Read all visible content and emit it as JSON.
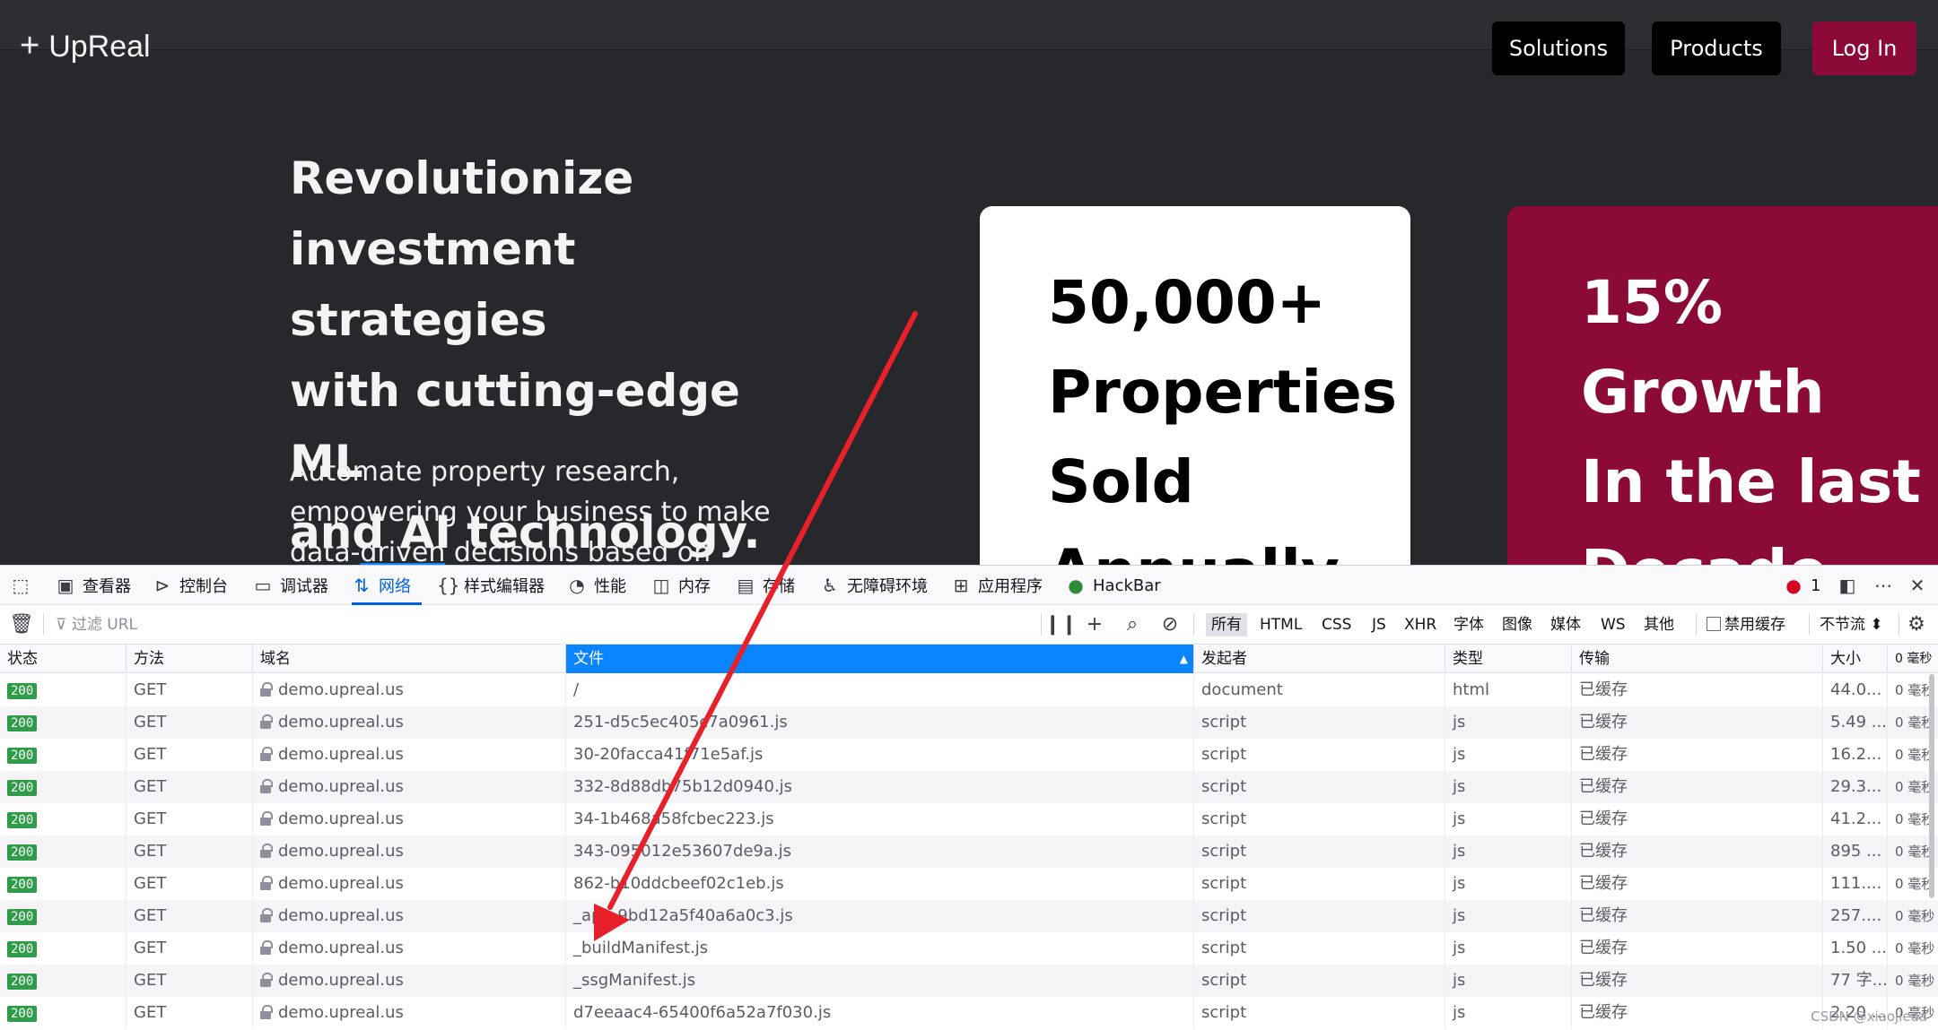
{
  "site": {
    "brand": "UpReal",
    "nav": {
      "solutions": "Solutions",
      "products": "Products",
      "login": "Log In"
    },
    "hero_title": [
      "Revolutionize",
      "investment strategies",
      "with cutting-edge ML",
      "and AI technology."
    ],
    "hero_sub": {
      "line1": "Automate property research,",
      "line2": "empowering your business to make",
      "line3a": "data-",
      "line3b": "driven",
      "line3c": " decisions based on"
    },
    "card1": [
      "50,000+",
      "Properties",
      "Sold",
      "Annually"
    ],
    "card2": [
      "15%",
      "Growth",
      "In the last",
      "Decade"
    ],
    "accent_color": "#8b0a37"
  },
  "devtools": {
    "tabs": {
      "inspector": "查看器",
      "console": "控制台",
      "debugger": "调试器",
      "network": "网络",
      "style_editor": "样式编辑器",
      "performance": "性能",
      "memory": "内存",
      "storage": "存储",
      "accessibility": "无障碍环境",
      "application": "应用程序",
      "hackbar": "HackBar"
    },
    "error_count": "1",
    "filter_placeholder": "过滤 URL",
    "filter_types": {
      "all": "所有",
      "html": "HTML",
      "css": "CSS",
      "js": "JS",
      "xhr": "XHR",
      "fonts": "字体",
      "images": "图像",
      "media": "媒体",
      "ws": "WS",
      "other": "其他"
    },
    "disable_cache": "禁用缓存",
    "throttle": "不节流 ⬍",
    "columns": {
      "status": "状态",
      "method": "方法",
      "domain": "域名",
      "file": "文件",
      "initiator": "发起者",
      "type": "类型",
      "transferred": "传输",
      "size": "大小",
      "timing": "0 毫秒"
    },
    "requests": [
      {
        "status": "200",
        "method": "GET",
        "domain": "demo.upreal.us",
        "file": "/",
        "initiator": "document",
        "type": "html",
        "transferred": "已缓存",
        "size": "44.0...",
        "timing": "0 毫秒"
      },
      {
        "status": "200",
        "method": "GET",
        "domain": "demo.upreal.us",
        "file": "251-d5c5ec405c7a0961.js",
        "initiator": "script",
        "type": "js",
        "transferred": "已缓存",
        "size": "5.49 ...",
        "timing": "0 毫秒"
      },
      {
        "status": "200",
        "method": "GET",
        "domain": "demo.upreal.us",
        "file": "30-20facca41f71e5af.js",
        "initiator": "script",
        "type": "js",
        "transferred": "已缓存",
        "size": "16.2...",
        "timing": "0 毫秒"
      },
      {
        "status": "200",
        "method": "GET",
        "domain": "demo.upreal.us",
        "file": "332-8d88db75b12d0940.js",
        "initiator": "script",
        "type": "js",
        "transferred": "已缓存",
        "size": "29.3...",
        "timing": "0 毫秒"
      },
      {
        "status": "200",
        "method": "GET",
        "domain": "demo.upreal.us",
        "file": "34-1b468a58fcbec223.js",
        "initiator": "script",
        "type": "js",
        "transferred": "已缓存",
        "size": "41.2...",
        "timing": "0 毫秒"
      },
      {
        "status": "200",
        "method": "GET",
        "domain": "demo.upreal.us",
        "file": "343-095012e53607de9a.js",
        "initiator": "script",
        "type": "js",
        "transferred": "已缓存",
        "size": "895 ...",
        "timing": "0 毫秒"
      },
      {
        "status": "200",
        "method": "GET",
        "domain": "demo.upreal.us",
        "file": "862-b10ddcbeef02c1eb.js",
        "initiator": "script",
        "type": "js",
        "transferred": "已缓存",
        "size": "111....",
        "timing": "0 毫秒"
      },
      {
        "status": "200",
        "method": "GET",
        "domain": "demo.upreal.us",
        "file": "_app-9bd12a5f40a6a0c3.js",
        "initiator": "script",
        "type": "js",
        "transferred": "已缓存",
        "size": "257....",
        "timing": "0 毫秒"
      },
      {
        "status": "200",
        "method": "GET",
        "domain": "demo.upreal.us",
        "file": "_buildManifest.js",
        "initiator": "script",
        "type": "js",
        "transferred": "已缓存",
        "size": "1.50 ...",
        "timing": "0 毫秒"
      },
      {
        "status": "200",
        "method": "GET",
        "domain": "demo.upreal.us",
        "file": "_ssgManifest.js",
        "initiator": "script",
        "type": "js",
        "transferred": "已缓存",
        "size": "77 字...",
        "timing": "0 毫秒"
      },
      {
        "status": "200",
        "method": "GET",
        "domain": "demo.upreal.us",
        "file": "d7eeaac4-65400f6a52a7f030.js",
        "initiator": "script",
        "type": "js",
        "transferred": "已缓存",
        "size": "2.20 ...",
        "timing": "0 毫秒"
      }
    ],
    "watermark": "CSDN @xiaojieaa"
  }
}
